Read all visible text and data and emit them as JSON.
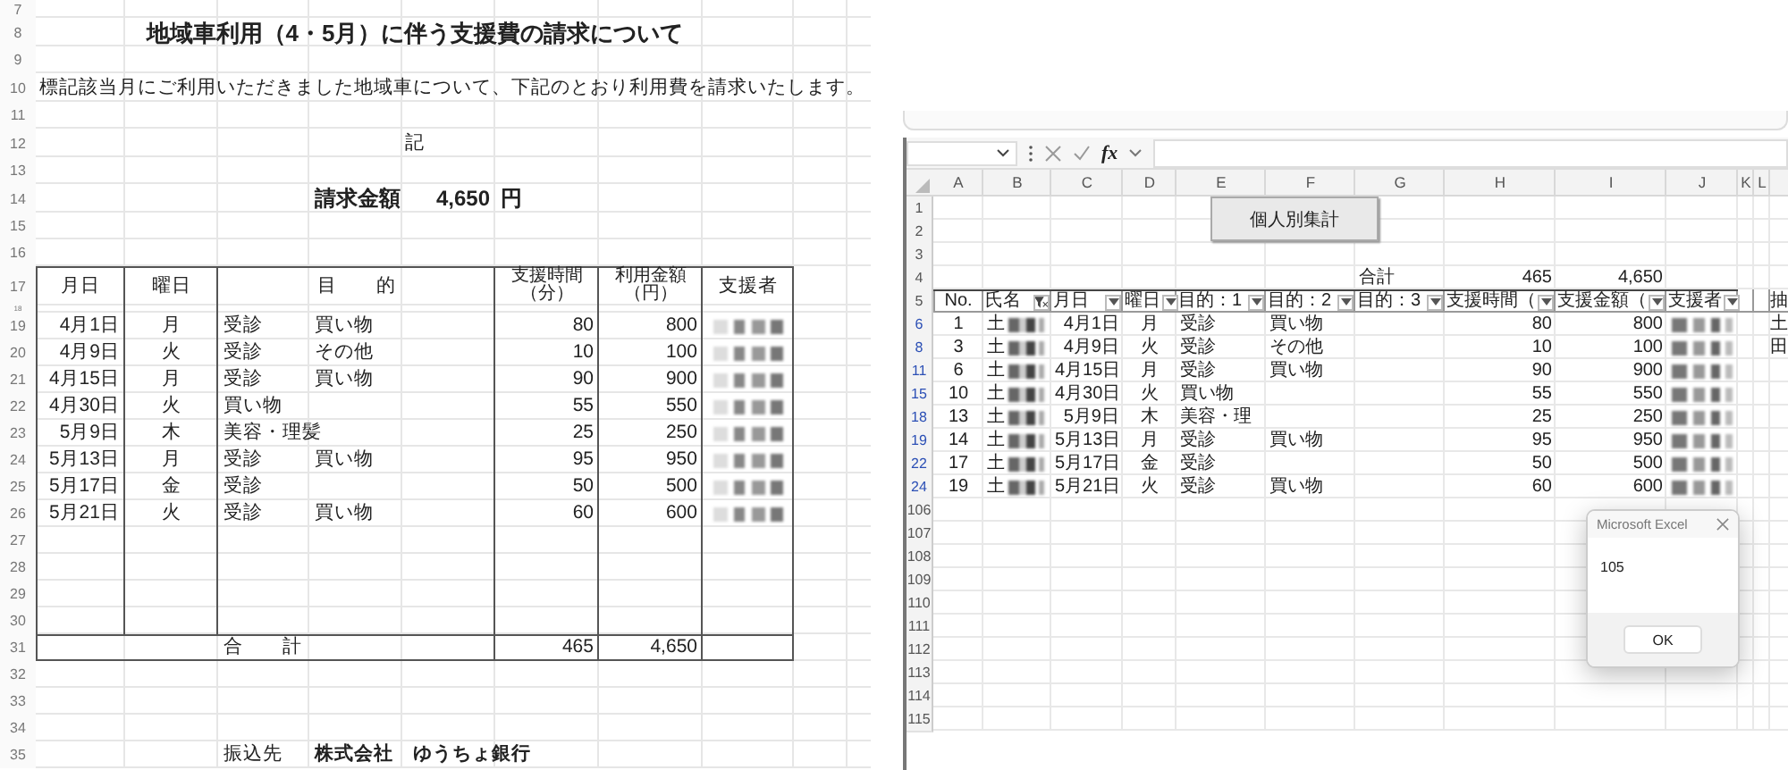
{
  "invoice": {
    "rows": [
      {
        "number": "7",
        "kind": "blank"
      },
      {
        "number": "8",
        "kind": "title",
        "text": "地域車利用（4・5月）に伴う支援費の請求について"
      },
      {
        "number": "9",
        "kind": "blank"
      },
      {
        "number": "10",
        "kind": "intro",
        "text": "標記該当月にご利用いただきました地域車について、下記のとおり利用費を請求いたします。"
      },
      {
        "number": "11",
        "kind": "blank"
      },
      {
        "number": "12",
        "kind": "center",
        "text": "記"
      },
      {
        "number": "13",
        "kind": "blank"
      },
      {
        "number": "14",
        "kind": "amount",
        "label": "請求金額",
        "value": "4,650",
        "unit": "円"
      },
      {
        "number": "15",
        "kind": "blank"
      },
      {
        "number": "16",
        "kind": "blank"
      },
      {
        "number": "17",
        "kind": "header",
        "cells": [
          "月日",
          "曜日",
          "目　　的",
          "支援時間（分）",
          "利用金額（円）",
          "支援者"
        ]
      },
      {
        "number": "18",
        "kind": "spacer"
      },
      {
        "number": "19",
        "kind": "data",
        "date": "4月1日",
        "weekday": "月",
        "purpose_1": "受診",
        "purpose_2": "買い物",
        "minutes": "80",
        "fee": "800"
      },
      {
        "number": "20",
        "kind": "data",
        "date": "4月9日",
        "weekday": "火",
        "purpose_1": "受診",
        "purpose_2": "その他",
        "minutes": "10",
        "fee": "100"
      },
      {
        "number": "21",
        "kind": "data",
        "date": "4月15日",
        "weekday": "月",
        "purpose_1": "受診",
        "purpose_2": "買い物",
        "minutes": "90",
        "fee": "900"
      },
      {
        "number": "22",
        "kind": "data",
        "date": "4月30日",
        "weekday": "火",
        "purpose_1": "買い物",
        "minutes": "55",
        "fee": "550"
      },
      {
        "number": "23",
        "kind": "data",
        "date": "5月9日",
        "weekday": "木",
        "purpose_1": "美容・理髪",
        "minutes": "25",
        "fee": "250"
      },
      {
        "number": "24",
        "kind": "data",
        "date": "5月13日",
        "weekday": "月",
        "purpose_1": "受診",
        "purpose_2": "買い物",
        "minutes": "95",
        "fee": "950"
      },
      {
        "number": "25",
        "kind": "data",
        "date": "5月17日",
        "weekday": "金",
        "purpose_1": "受診",
        "minutes": "50",
        "fee": "500"
      },
      {
        "number": "26",
        "kind": "data",
        "date": "5月21日",
        "weekday": "火",
        "purpose_1": "受診",
        "purpose_2": "買い物",
        "minutes": "60",
        "fee": "600"
      },
      {
        "number": "27",
        "kind": "empty"
      },
      {
        "number": "28",
        "kind": "empty"
      },
      {
        "number": "29",
        "kind": "empty"
      },
      {
        "number": "30",
        "kind": "empty"
      },
      {
        "number": "31",
        "kind": "total",
        "label": "合　　計",
        "minutes": "465",
        "fee": "4,650"
      },
      {
        "number": "32",
        "kind": "blank"
      },
      {
        "number": "33",
        "kind": "blank"
      },
      {
        "number": "34",
        "kind": "blank"
      },
      {
        "number": "35",
        "kind": "payee",
        "label": "振込先",
        "value": "株式会社　ゆうちょ銀行"
      }
    ]
  },
  "excel": {
    "formula_bar": {
      "fx": "fx"
    },
    "column_letters": [
      "A",
      "B",
      "C",
      "D",
      "E",
      "F",
      "G",
      "H",
      "I",
      "J",
      "K",
      "L"
    ],
    "macro_button": "個人別集計",
    "table_headers": [
      {
        "label": "No.",
        "kind": "plain"
      },
      {
        "label": "氏名",
        "kind": "filtered"
      },
      {
        "label": "月日",
        "kind": "dropdown"
      },
      {
        "label": "曜日",
        "kind": "dropdown"
      },
      {
        "label": "目的：1",
        "kind": "dropdown"
      },
      {
        "label": "目的：2",
        "kind": "dropdown"
      },
      {
        "label": "目的：3",
        "kind": "dropdown"
      },
      {
        "label": "支援時間（",
        "kind": "dropdown"
      },
      {
        "label": "支援金額（",
        "kind": "dropdown"
      },
      {
        "label": "支援者",
        "kind": "dropdown"
      }
    ],
    "rows": [
      {
        "number": "1",
        "kind": "blank"
      },
      {
        "number": "2",
        "kind": "blank"
      },
      {
        "number": "3",
        "kind": "blank"
      },
      {
        "number": "4",
        "kind": "sum",
        "label": "合計",
        "minutes": "465",
        "fee": "4,650"
      },
      {
        "number": "5",
        "kind": "header",
        "extra": "抽"
      },
      {
        "number": "6",
        "kind": "data",
        "no": "1",
        "name": "土",
        "date": "4月1日",
        "weekday": "月",
        "purpose_1": "受診",
        "purpose_2": "買い物",
        "minutes": "80",
        "fee": "800",
        "extra": "土"
      },
      {
        "number": "8",
        "kind": "data",
        "no": "3",
        "name": "土",
        "date": "4月9日",
        "weekday": "火",
        "purpose_1": "受診",
        "purpose_2": "その他",
        "minutes": "10",
        "fee": "100",
        "extra": "田"
      },
      {
        "number": "11",
        "kind": "data",
        "no": "6",
        "name": "土",
        "date": "4月15日",
        "weekday": "月",
        "purpose_1": "受診",
        "purpose_2": "買い物",
        "minutes": "90",
        "fee": "900"
      },
      {
        "number": "15",
        "kind": "data",
        "no": "10",
        "name": "土",
        "date": "4月30日",
        "weekday": "火",
        "purpose_1": "買い物",
        "minutes": "55",
        "fee": "550"
      },
      {
        "number": "18",
        "kind": "data",
        "no": "13",
        "name": "土",
        "date": "5月9日",
        "weekday": "木",
        "purpose_1": "美容・理",
        "minutes": "25",
        "fee": "250"
      },
      {
        "number": "19",
        "kind": "data",
        "no": "14",
        "name": "土",
        "date": "5月13日",
        "weekday": "月",
        "purpose_1": "受診",
        "purpose_2": "買い物",
        "minutes": "95",
        "fee": "950"
      },
      {
        "number": "22",
        "kind": "data",
        "no": "17",
        "name": "土",
        "date": "5月17日",
        "weekday": "金",
        "purpose_1": "受診",
        "minutes": "50",
        "fee": "500"
      },
      {
        "number": "24",
        "kind": "data",
        "no": "19",
        "name": "土",
        "date": "5月21日",
        "weekday": "火",
        "purpose_1": "受診",
        "purpose_2": "買い物",
        "minutes": "60",
        "fee": "600"
      },
      {
        "number": "106",
        "kind": "blank"
      },
      {
        "number": "107",
        "kind": "blank"
      },
      {
        "number": "108",
        "kind": "blank"
      },
      {
        "number": "109",
        "kind": "blank"
      },
      {
        "number": "110",
        "kind": "blank"
      },
      {
        "number": "111",
        "kind": "blank"
      },
      {
        "number": "112",
        "kind": "blank"
      },
      {
        "number": "113",
        "kind": "blank"
      },
      {
        "number": "114",
        "kind": "blank"
      },
      {
        "number": "115",
        "kind": "blank"
      }
    ],
    "dialog": {
      "title": "Microsoft Excel",
      "message": "105",
      "button": "OK"
    }
  }
}
